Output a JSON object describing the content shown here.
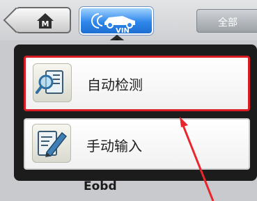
{
  "toolbar": {
    "home_button": {
      "icon": "home-icon",
      "letter": "M"
    },
    "vin_button": {
      "icon": "car-vin-icon",
      "label": "VIN"
    },
    "all_button": {
      "label": "全部"
    }
  },
  "popup_menu": {
    "items": [
      {
        "label": "自动检测",
        "icon": "magnifier-check-icon",
        "selected": true
      },
      {
        "label": "手动输入",
        "icon": "pencil-edit-icon",
        "selected": false
      }
    ]
  },
  "background": {
    "item_label": "Eobd"
  },
  "colors": {
    "selection_border": "#d81e24",
    "vin_button": "#2f86ea",
    "popup_bg": "#1c1c1c",
    "annotation_arrow": "#e8262b"
  }
}
